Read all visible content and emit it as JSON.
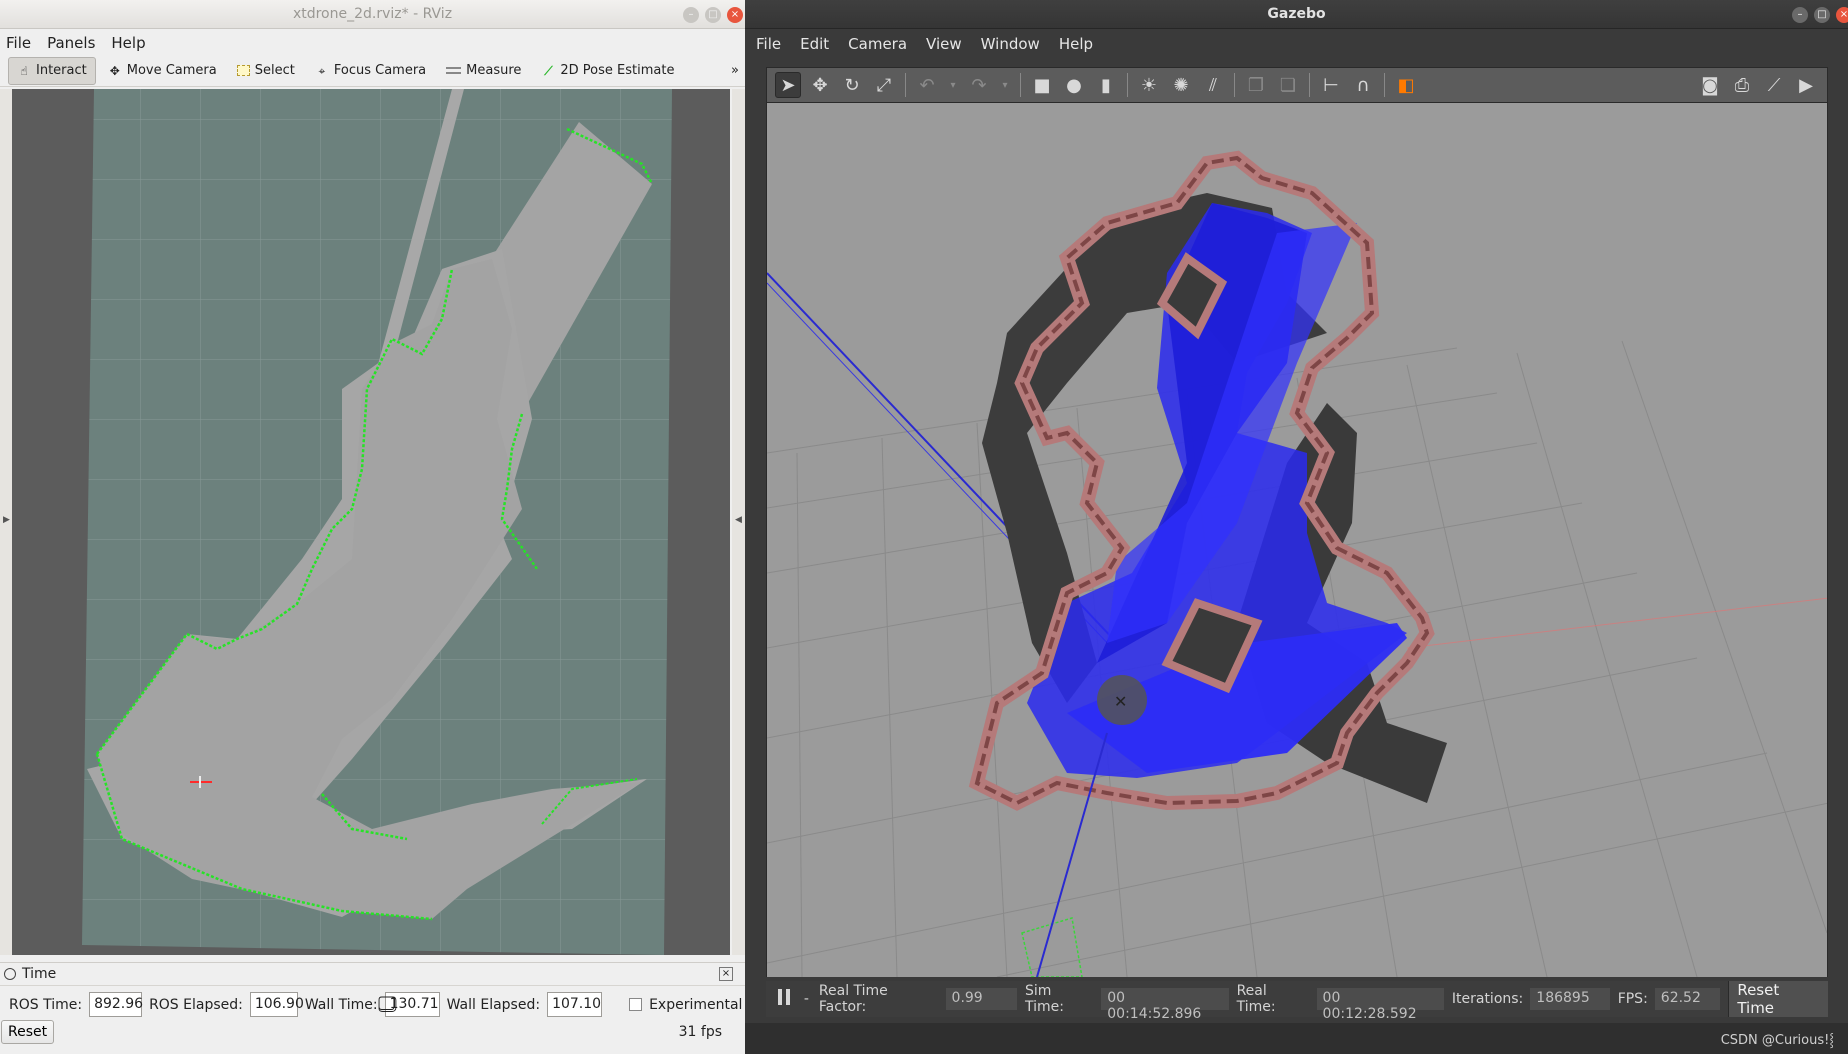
{
  "rviz": {
    "title": "xtdrone_2d.rviz* - RViz",
    "menu": [
      "File",
      "Panels",
      "Help"
    ],
    "tools": [
      {
        "label": "Interact",
        "icon": "hand-icon"
      },
      {
        "label": "Move Camera",
        "icon": "move-camera-icon"
      },
      {
        "label": "Select",
        "icon": "select-icon"
      },
      {
        "label": "Focus Camera",
        "icon": "focus-camera-icon"
      },
      {
        "label": "Measure",
        "icon": "ruler-icon"
      },
      {
        "label": "2D Pose Estimate",
        "icon": "pose-arrow-icon"
      }
    ],
    "overflow": "»",
    "time_panel": {
      "title": "Time",
      "ros_time_label": "ROS Time:",
      "ros_time": "892.96",
      "ros_elapsed_label": "ROS Elapsed:",
      "ros_elapsed": "106.90",
      "wall_time_label": "Wall Time:",
      "wall_time": "⃣130.71",
      "wall_elapsed_label": "Wall Elapsed:",
      "wall_elapsed": "107.10",
      "experimental_label": "Experimental",
      "reset_label": "Reset",
      "fps": "31 fps"
    }
  },
  "gazebo": {
    "title": "Gazebo",
    "menu": [
      "File",
      "Edit",
      "Camera",
      "View",
      "Window",
      "Help"
    ],
    "status": {
      "dash": "-",
      "real_time_factor_label": "Real Time Factor:",
      "real_time_factor": "0.99",
      "sim_time_label": "Sim Time:",
      "sim_time": "00 00:14:52.896",
      "real_time_label": "Real Time:",
      "real_time": "00 00:12:28.592",
      "iterations_label": "Iterations:",
      "iterations": "186895",
      "fps_label": "FPS:",
      "fps": "62.52",
      "reset_time_label": "Reset Time"
    }
  },
  "watermark": "CSDN @Curious!⸾",
  "colors": {
    "laser_blue": "#1a1aff",
    "scan_green": "#22e022",
    "map_free": "#a0a0a0",
    "map_unknown": "#6b817d",
    "wall": "#a66a6a"
  }
}
